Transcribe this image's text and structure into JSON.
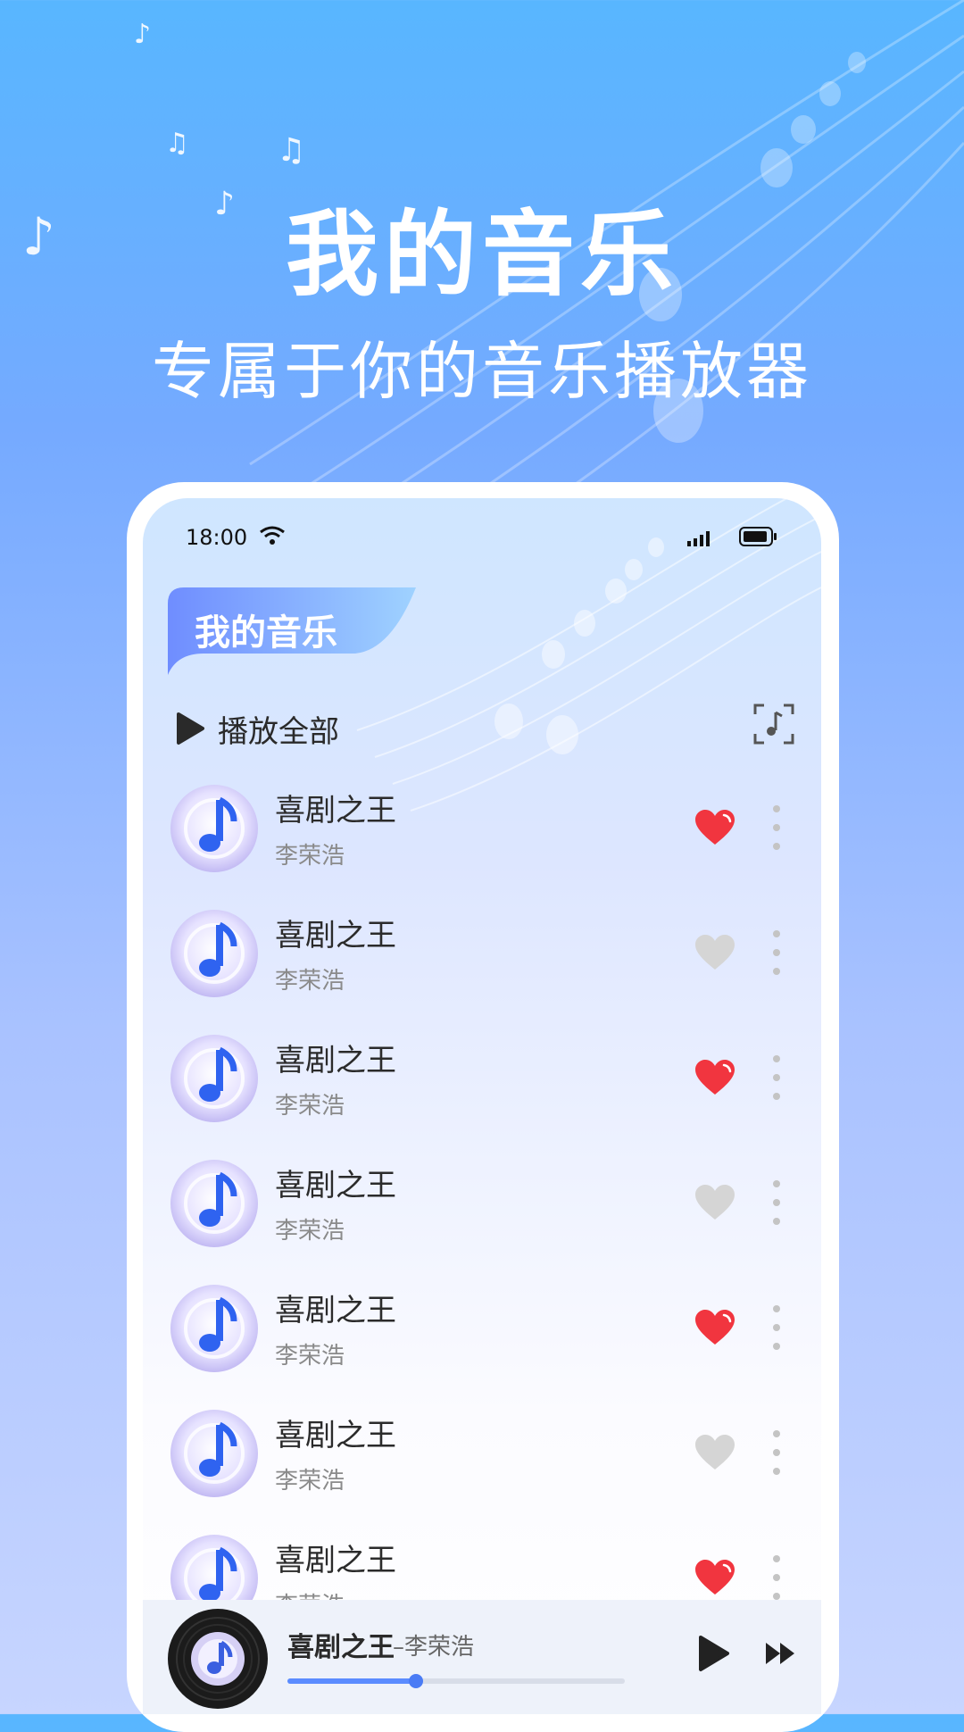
{
  "hero": {
    "title": "我的音乐",
    "subtitle": "专属于你的音乐播放器"
  },
  "status_bar": {
    "time": "18:00",
    "wifi_icon": "wifi-icon",
    "signal_icon": "signal-icon",
    "battery_icon": "battery-icon"
  },
  "header": {
    "title": "我的音乐"
  },
  "play_all": {
    "label": "播放全部",
    "icon": "play-icon",
    "scan_icon": "music-scan-icon"
  },
  "songs": [
    {
      "title": "喜剧之王",
      "artist": "李荣浩",
      "liked": true
    },
    {
      "title": "喜剧之王",
      "artist": "李荣浩",
      "liked": false
    },
    {
      "title": "喜剧之王",
      "artist": "李荣浩",
      "liked": true
    },
    {
      "title": "喜剧之王",
      "artist": "李荣浩",
      "liked": false
    },
    {
      "title": "喜剧之王",
      "artist": "李荣浩",
      "liked": true
    },
    {
      "title": "喜剧之王",
      "artist": "李荣浩",
      "liked": false
    },
    {
      "title": "喜剧之王",
      "artist": "李荣浩",
      "liked": true
    }
  ],
  "now_playing": {
    "title": "喜剧之王",
    "artist": "–李荣浩",
    "progress": 0.38
  },
  "colors": {
    "liked": "#f1353f",
    "unliked": "#d5d5d5",
    "accent": "#5b8cff"
  }
}
